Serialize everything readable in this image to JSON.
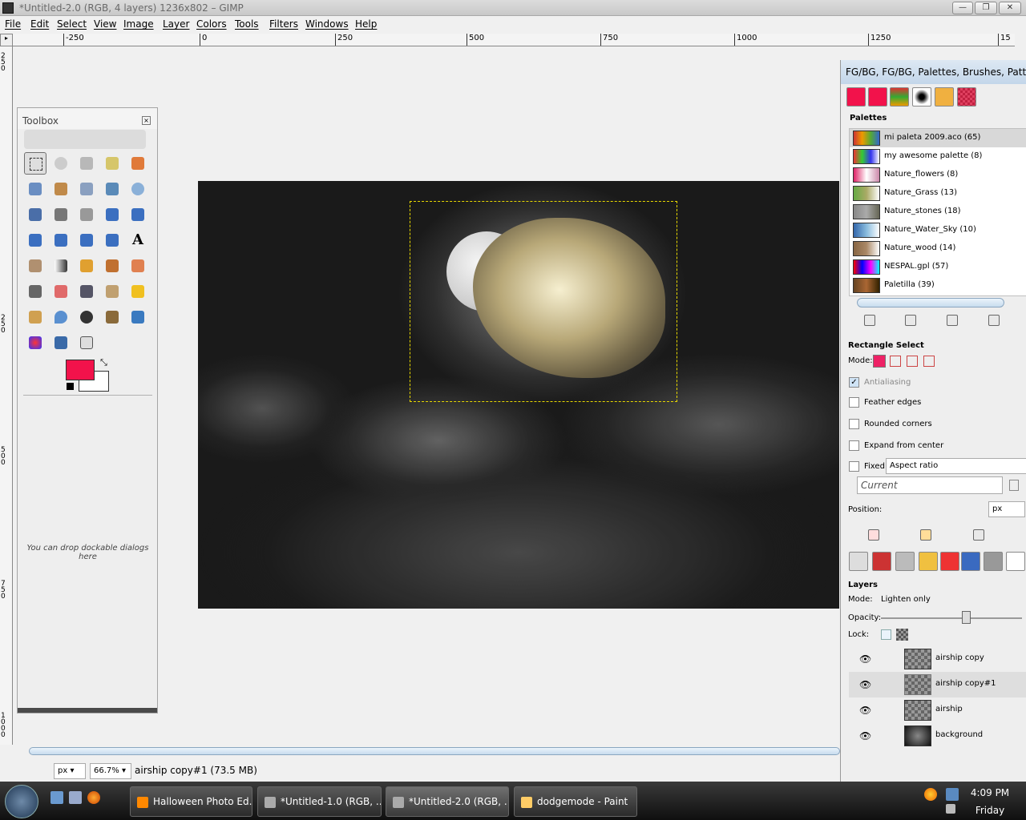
{
  "window": {
    "title": "*Untitled-2.0 (RGB, 4 layers) 1236x802 – GIMP"
  },
  "menu": [
    "File",
    "Edit",
    "Select",
    "View",
    "Image",
    "Layer",
    "Colors",
    "Tools",
    "Filters",
    "Windows",
    "Help"
  ],
  "ruler": {
    "h": [
      "-250",
      "0",
      "250",
      "500",
      "750",
      "1000",
      "1250",
      "15"
    ],
    "v": [
      "250",
      "500",
      "750",
      "1000"
    ]
  },
  "toolbox": {
    "title": "Toolbox",
    "drop_hint": "You can drop dockable dialogs here"
  },
  "colors": {
    "fg": "#f2124b",
    "bg": "#ffffff",
    "selection": "#e8d800"
  },
  "dock": {
    "title": "FG/BG, FG/BG, Palettes, Brushes, Patterns,",
    "palettes_label": "Palettes",
    "palettes": [
      "mi paleta 2009.aco (65)",
      "my awesome palette (8)",
      "Nature_flowers (8)",
      "Nature_Grass (13)",
      "Nature_stones (18)",
      "Nature_Water_Sky (10)",
      "Nature_wood (14)",
      "NESPAL.gpl (57)",
      "Paletilla (39)"
    ],
    "tool_options": {
      "title": "Rectangle Select",
      "mode_label": "Mode:",
      "antialiasing": "Antialiasing",
      "feather": "Feather edges",
      "rounded": "Rounded corners",
      "expand": "Expand from center",
      "fixed": "Fixed:",
      "fixed_value": "Aspect ratio",
      "current": "Current",
      "position": "Position:",
      "unit": "px"
    },
    "layers": {
      "title": "Layers",
      "mode_label": "Mode:",
      "mode_value": "Lighten only",
      "opacity_label": "Opacity:",
      "lock_label": "Lock:",
      "items": [
        "airship copy",
        "airship copy#1",
        "airship",
        "background"
      ]
    }
  },
  "status": {
    "unit": "px",
    "zoom": "66.7%",
    "message": "airship copy#1 (73.5 MB)"
  },
  "taskbar": {
    "tasks": [
      "Halloween Photo Ed...",
      "*Untitled-1.0 (RGB, ...",
      "*Untitled-2.0 (RGB, ...",
      "dodgemode - Paint"
    ],
    "time": "4:09 PM",
    "day": "Friday"
  }
}
